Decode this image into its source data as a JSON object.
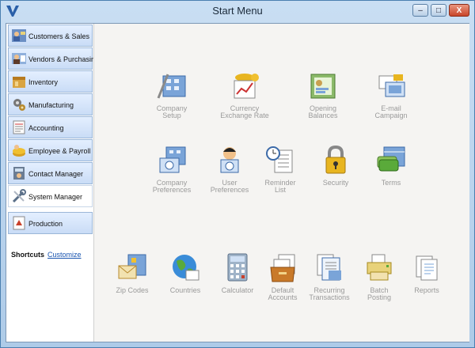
{
  "window": {
    "title": "Start Menu",
    "minimize": "–",
    "restore": "□",
    "close": "X"
  },
  "sidebar": {
    "items": [
      {
        "label": "Customers & Sales"
      },
      {
        "label": "Vendors & Purchasing"
      },
      {
        "label": "Inventory"
      },
      {
        "label": "Manufacturing"
      },
      {
        "label": "Accounting"
      },
      {
        "label": "Employee & Payroll"
      },
      {
        "label": "Contact Manager"
      },
      {
        "label": "System Manager"
      },
      {
        "label": "Production"
      }
    ],
    "active_item": "System Manager"
  },
  "shortcuts": {
    "label": "Shortcuts",
    "customize": "Customize"
  },
  "content": {
    "items": [
      {
        "label1": "Company",
        "label2": "Setup"
      },
      {
        "label1": "Currency",
        "label2": "Exchange Rate"
      },
      {
        "label1": "Opening",
        "label2": "Balances"
      },
      {
        "label1": "E-mail",
        "label2": "Campaign"
      },
      {
        "label1": "Company",
        "label2": "Preferences"
      },
      {
        "label1": "User",
        "label2": "Preferences"
      },
      {
        "label1": "Reminder",
        "label2": "List"
      },
      {
        "label1": "Security",
        "label2": ""
      },
      {
        "label1": "Terms",
        "label2": ""
      },
      {
        "label1": "Zip Codes",
        "label2": ""
      },
      {
        "label1": "Countries",
        "label2": ""
      },
      {
        "label1": "Calculator",
        "label2": ""
      },
      {
        "label1": "Default",
        "label2": "Accounts"
      },
      {
        "label1": "Recurring",
        "label2": "Transactions"
      },
      {
        "label1": "Batch",
        "label2": "Posting"
      },
      {
        "label1": "Reports",
        "label2": ""
      }
    ]
  }
}
